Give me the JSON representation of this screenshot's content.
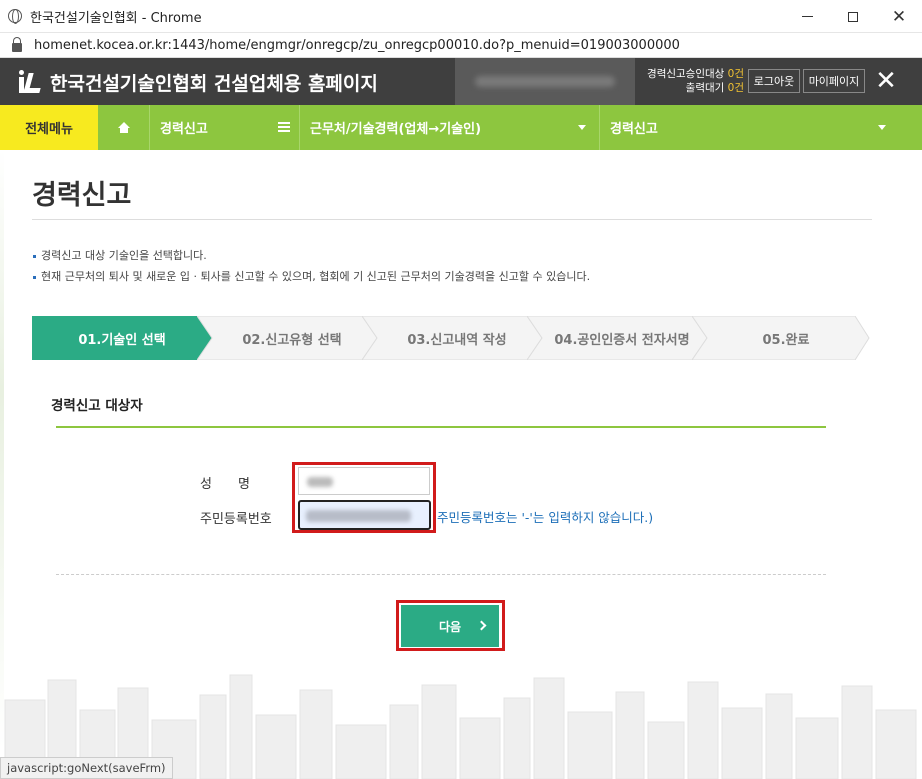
{
  "browser": {
    "window_title": "한국건설기술인협회 - Chrome",
    "url": "homenet.kocea.or.kr:1443/home/engmgr/onregcp/zu_onregcp00010.do?p_menuid=019003000000",
    "status_text": "javascript:goNext(saveFrm)"
  },
  "header": {
    "site_title": "한국건설기술인협회 건설업체용 홈페이지",
    "stat1_label": "경력신고승인대상",
    "stat1_value": "0건",
    "stat2_label": "출력대기",
    "stat2_value": "0건",
    "logout_label": "로그아웃",
    "mypage_label": "마이페이지",
    "close_label": "✕"
  },
  "nav": {
    "menu_all": "전체메뉴",
    "seg1": "경력신고",
    "seg2": "근무처/기술경력(업체→기술인)",
    "seg3": "경력신고"
  },
  "main": {
    "page_title": "경력신고",
    "note1": "경력신고 대상 기술인을 선택합니다.",
    "note2": "현재 근무처의 퇴사 및 새로운 입 · 퇴사를 신고할 수 있으며, 협회에 기 신고된 근무처의 기술경력을 신고할 수 있습니다.",
    "steps": [
      {
        "label": "01.기술인 선택",
        "active": true
      },
      {
        "label": "02.신고유형 선택",
        "active": false
      },
      {
        "label": "03.신고내역 작성",
        "active": false
      },
      {
        "label": "04.공인인증서 전자서명",
        "active": false
      },
      {
        "label": "05.완료",
        "active": false
      }
    ],
    "section_title": "경력신고 대상자",
    "name_label": "성　　명",
    "rrn_label": "주민등록번호",
    "rrn_hint": "주민등록번호는 '-'는 입력하지 않습니다.)",
    "next_label": "다음"
  },
  "colors": {
    "accent_green": "#8dc63f",
    "step_active": "#2bab85",
    "menu_yellow": "#f7ea1f",
    "highlight_red": "#d11b1b"
  }
}
